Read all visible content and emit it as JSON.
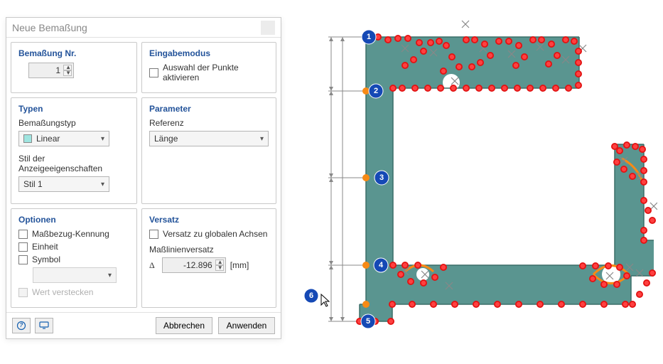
{
  "dialog": {
    "title": "Neue Bemaßung",
    "groups": {
      "nr": {
        "heading": "Bemaßung Nr.",
        "value": "1"
      },
      "input": {
        "heading": "Eingabemodus",
        "activate_points": "Auswahl der Punkte aktivieren"
      },
      "types": {
        "heading": "Typen",
        "type_label": "Bemaßungstyp",
        "type_value": "Linear",
        "style_label": "Stil der Anzeigeeigenschaften",
        "style_value": "Stil 1"
      },
      "param": {
        "heading": "Parameter",
        "ref_label": "Referenz",
        "ref_value": "Länge"
      },
      "options": {
        "heading": "Optionen",
        "datum": "Maßbezug-Kennung",
        "unit": "Einheit",
        "symbol": "Symbol",
        "hide_value": "Wert verstecken"
      },
      "offset": {
        "heading": "Versatz",
        "global": "Versatz zu globalen Achsen",
        "offset_label": "Maßlinienversatz",
        "delta": "Δ",
        "value": "-12.896",
        "unit": "[mm]"
      }
    },
    "buttons": {
      "cancel": "Abbrechen",
      "apply": "Anwenden"
    }
  },
  "drawing": {
    "markers": [
      "1",
      "2",
      "3",
      "4",
      "5",
      "6"
    ]
  }
}
